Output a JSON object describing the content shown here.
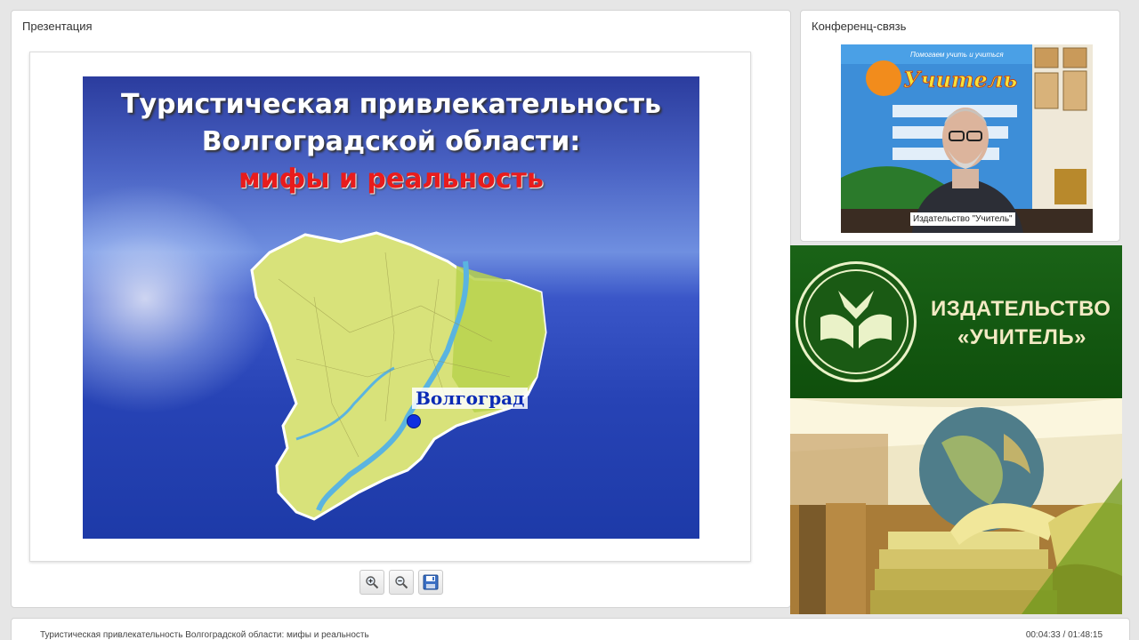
{
  "presentation": {
    "title": "Презентация",
    "slide": {
      "title_line1": "Туристическая привлекательность",
      "title_line2": "Волгоградской области:",
      "title_line3": "мифы и реальность",
      "city_label": "Волгоград"
    },
    "toolbar": [
      {
        "name": "zoom-in-button",
        "icon": "zoom-in-icon"
      },
      {
        "name": "zoom-out-button",
        "icon": "zoom-out-icon"
      },
      {
        "name": "save-button",
        "icon": "save-icon"
      }
    ]
  },
  "conference": {
    "title": "Конференц-связь",
    "speaker_label": "Издательство \"Учитель\"",
    "backdrop_slogan": "Помогаем учить и учиться",
    "backdrop_brand": "Учитель"
  },
  "banner": {
    "line1": "ИЗДАТЕЛЬСТВО",
    "line2": "«УЧИТЕЛЬ»"
  },
  "footer": {
    "title": "Туристическая привлекательность Волгоградской области: мифы и реальность",
    "time": "00:04:33 / 01:48:15"
  },
  "colors": {
    "banner_green": "#145a11",
    "slide_blue": "#2a45b8",
    "slide_accent_red": "#e81c1c"
  }
}
